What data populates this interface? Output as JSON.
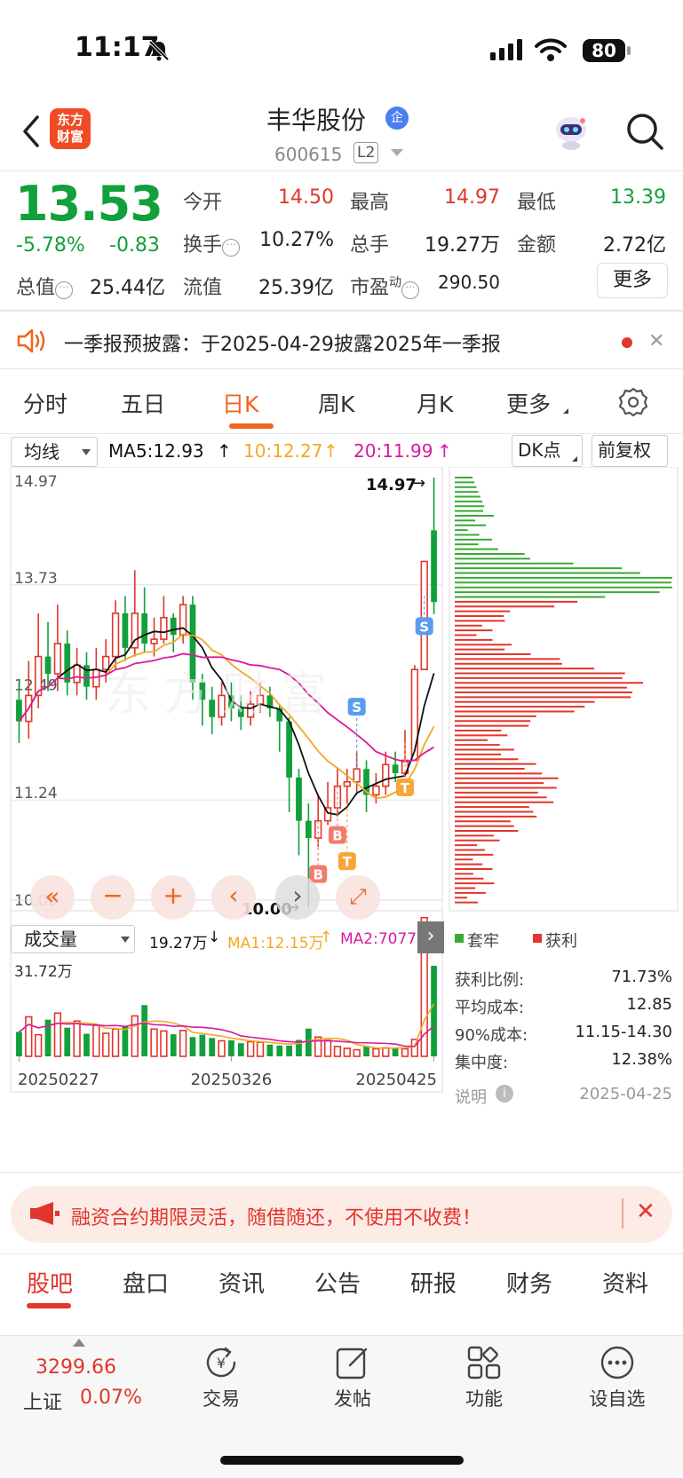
{
  "status": {
    "time": "11:17",
    "battery": "80"
  },
  "header": {
    "logo_line1": "东方",
    "logo_line2": "财富",
    "name": "丰华股份",
    "qi": "企",
    "code": "600615",
    "level": "L2"
  },
  "quote": {
    "price": "13.53",
    "pct": "-5.78%",
    "chg": "-0.83",
    "open_label": "今开",
    "open": "14.50",
    "high_label": "最高",
    "high": "14.97",
    "low_label": "最低",
    "low": "13.39",
    "turnover_label": "换手",
    "turnover": "10.27%",
    "volume_label": "总手",
    "volume": "19.27万",
    "amount_label": "金额",
    "amount": "2.72亿",
    "mktcap_label": "总值",
    "mktcap": "25.44亿",
    "float_label": "流值",
    "float": "25.39亿",
    "pe_label": "市盈",
    "pe_sup": "动",
    "pe": "290.50",
    "more": "更多"
  },
  "notice": {
    "text": "一季报预披露：于2025-04-29披露2025年一季报"
  },
  "period_tabs": [
    {
      "label": "分时"
    },
    {
      "label": "五日"
    },
    {
      "label": "日K"
    },
    {
      "label": "周K"
    },
    {
      "label": "月K"
    },
    {
      "label": "更多"
    }
  ],
  "chart_controls": {
    "indicator": "均线",
    "ma5": "MA5:12.93",
    "ma10": "10:12.27",
    "ma20": "20:11.99",
    "dk": "DK点",
    "adjust": "前复权",
    "vol_indicator": "成交量",
    "vol_now": "19.27万",
    "vol_ma1": "MA1:12.15万",
    "vol_ma2": "MA2:70779"
  },
  "colors": {
    "up": "#e0362c",
    "down": "#11a03b",
    "accent": "#f0651c",
    "ma5": "#111111",
    "ma10": "#f5a623",
    "ma20": "#d81b9c"
  },
  "chart_data": {
    "type": "candlestick",
    "y_ticks": [
      "14.97",
      "13.73",
      "12.49",
      "11.24",
      "10.00"
    ],
    "ylim": [
      10.0,
      14.97
    ],
    "max_label": "14.97",
    "min_label": "10.00",
    "x_ticks": [
      "20250227",
      "20250326",
      "20250425"
    ],
    "vol_max_label": "31.72万",
    "vol_ylim": [
      0,
      31.72
    ],
    "candles": [
      [
        12.4,
        12.15,
        12.6,
        11.9
      ],
      [
        12.15,
        12.45,
        12.85,
        11.95
      ],
      [
        12.45,
        12.9,
        13.4,
        12.3
      ],
      [
        12.9,
        12.7,
        13.3,
        12.5
      ],
      [
        12.7,
        13.05,
        13.5,
        12.5
      ],
      [
        13.05,
        12.6,
        13.2,
        12.45
      ],
      [
        12.6,
        12.8,
        13.0,
        12.45
      ],
      [
        12.8,
        12.55,
        12.95,
        12.4
      ],
      [
        12.55,
        12.75,
        13.0,
        12.4
      ],
      [
        12.75,
        12.9,
        13.1,
        12.6
      ],
      [
        12.9,
        13.4,
        13.55,
        12.75
      ],
      [
        13.4,
        13.0,
        13.6,
        12.85
      ],
      [
        13.0,
        13.4,
        13.9,
        12.9
      ],
      [
        13.4,
        13.05,
        13.7,
        12.95
      ],
      [
        13.05,
        13.1,
        13.35,
        12.9
      ],
      [
        13.1,
        13.35,
        13.6,
        13.05
      ],
      [
        13.35,
        13.15,
        13.4,
        12.95
      ],
      [
        13.15,
        13.5,
        13.6,
        13.05
      ],
      [
        13.5,
        12.6,
        13.6,
        12.4
      ],
      [
        12.6,
        12.4,
        12.7,
        12.1
      ],
      [
        12.4,
        12.2,
        12.55,
        12.0
      ],
      [
        12.2,
        12.45,
        12.6,
        12.1
      ],
      [
        12.45,
        12.3,
        12.6,
        12.15
      ],
      [
        12.3,
        12.2,
        12.45,
        12.05
      ],
      [
        12.2,
        12.35,
        12.5,
        12.1
      ],
      [
        12.35,
        12.45,
        12.6,
        12.25
      ],
      [
        12.45,
        12.3,
        12.55,
        12.2
      ],
      [
        12.3,
        12.15,
        12.35,
        11.8
      ],
      [
        12.15,
        11.5,
        12.2,
        11.1
      ],
      [
        11.5,
        11.0,
        11.6,
        10.6
      ],
      [
        11.0,
        10.8,
        11.2,
        10.0
      ],
      [
        10.8,
        11.0,
        11.3,
        10.7
      ],
      [
        11.0,
        11.15,
        11.45,
        10.95
      ],
      [
        11.15,
        11.4,
        11.6,
        11.05
      ],
      [
        11.4,
        11.45,
        11.6,
        11.2
      ],
      [
        11.45,
        11.6,
        11.8,
        11.3
      ],
      [
        11.6,
        11.3,
        11.7,
        11.1
      ],
      [
        11.3,
        11.4,
        11.55,
        11.2
      ],
      [
        11.4,
        11.65,
        11.8,
        11.3
      ],
      [
        11.65,
        11.55,
        11.8,
        11.45
      ],
      [
        11.55,
        11.7,
        12.05,
        11.5
      ],
      [
        11.7,
        12.75,
        12.8,
        11.7
      ],
      [
        12.75,
        14.0,
        14.0,
        12.75
      ],
      [
        14.36,
        13.53,
        14.97,
        13.39
      ]
    ],
    "volumes": [
      5.2,
      8.4,
      4.6,
      7.8,
      9.2,
      6.1,
      7.5,
      4.8,
      6.6,
      4.9,
      5.8,
      6.4,
      8.6,
      10.9,
      5.8,
      5.4,
      4.7,
      5.5,
      4.1,
      4.6,
      3.9,
      3.3,
      3.4,
      2.8,
      3.1,
      3.0,
      2.5,
      2.3,
      2.3,
      3.5,
      5.9,
      4.1,
      3.4,
      2.1,
      1.7,
      1.4,
      2.1,
      1.6,
      1.8,
      1.9,
      1.6,
      3.6,
      29.5,
      19.27
    ]
  },
  "chip_legend": {
    "trapped": "套牢",
    "profit": "获利"
  },
  "chip_stats": [
    {
      "label": "获利比例:",
      "value": "71.73%"
    },
    {
      "label": "平均成本:",
      "value": "12.85"
    },
    {
      "label": "90%成本:",
      "value": "11.15-14.30"
    },
    {
      "label": "集中度:",
      "value": "12.38%"
    }
  ],
  "chip_note": {
    "label": "说明",
    "date": "2025-04-25"
  },
  "banner": {
    "text": "融资合约期限灵活，随借随还，不使用不收费！"
  },
  "bottom_tabs": [
    {
      "label": "股吧"
    },
    {
      "label": "盘口"
    },
    {
      "label": "资讯"
    },
    {
      "label": "公告"
    },
    {
      "label": "研报"
    },
    {
      "label": "财务"
    },
    {
      "label": "资料"
    }
  ],
  "bottom_nav": {
    "index_value": "3299.66",
    "index_name": "上证",
    "index_pct": "0.07%",
    "items": [
      {
        "label": "交易"
      },
      {
        "label": "发帖"
      },
      {
        "label": "功能"
      },
      {
        "label": "设自选"
      }
    ]
  }
}
